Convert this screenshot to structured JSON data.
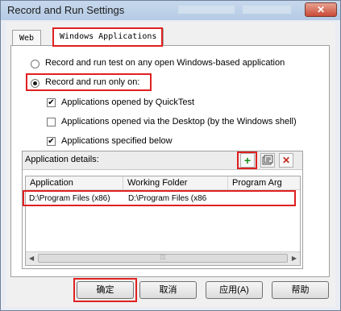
{
  "window": {
    "title": "Record and Run Settings",
    "close_glyph": "✕"
  },
  "tabs": [
    {
      "label": "Web"
    },
    {
      "label": "Windows Applications"
    }
  ],
  "options": {
    "radio_any": "Record and run test on any open Windows-based application",
    "radio_only": "Record and run only on:",
    "check_quicktest": "Applications opened by QuickTest",
    "check_desktop": "Applications opened via the Desktop (by the Windows shell)",
    "check_specified": "Applications specified below",
    "check_glyph": "✔"
  },
  "details": {
    "label": "Application details:",
    "add_glyph": "+",
    "remove_glyph": "✕",
    "columns": [
      "Application",
      "Working Folder",
      "Program Arg"
    ],
    "rows": [
      [
        "D:\\Program Files (x86)",
        "D:\\Program Files (x86"
      ]
    ]
  },
  "footer": {
    "ok": "确定",
    "cancel": "取消",
    "apply": "应用(A)",
    "help": "帮助"
  },
  "colors": {
    "highlight": "#e02020",
    "add_icon": "#1a8c1a",
    "delete_icon": "#c42b1c"
  }
}
